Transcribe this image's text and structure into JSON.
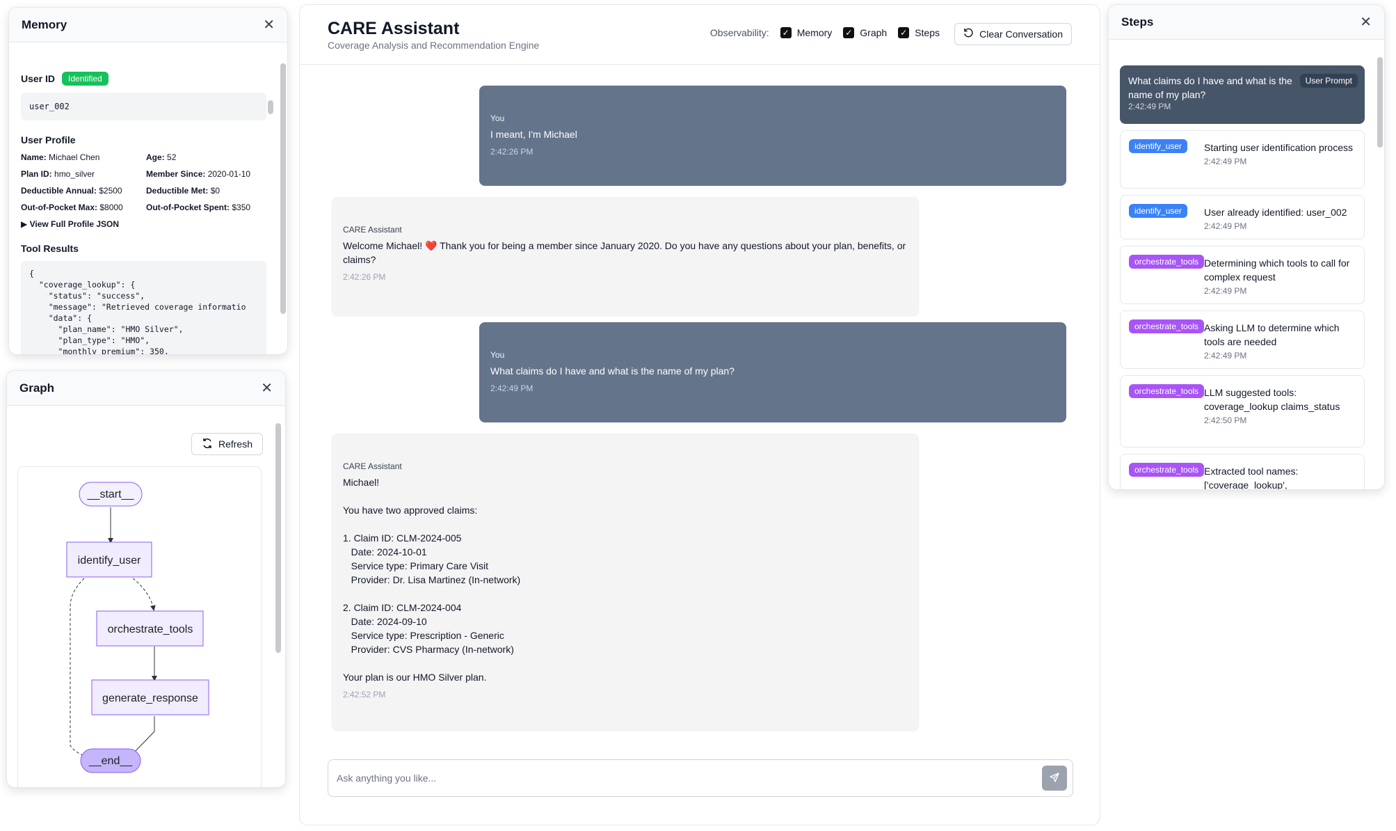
{
  "memory": {
    "title": "Memory",
    "user_id_label": "User ID",
    "identified_badge": "Identified",
    "user_id_value": "user_002",
    "profile_title": "User Profile",
    "profile": [
      {
        "label": "Name:",
        "value": "Michael Chen"
      },
      {
        "label": "Age:",
        "value": "52"
      },
      {
        "label": "Plan ID:",
        "value": "hmo_silver"
      },
      {
        "label": "Member Since:",
        "value": "2020-01-10"
      },
      {
        "label": "Deductible Annual:",
        "value": "$2500"
      },
      {
        "label": "Deductible Met:",
        "value": "$0"
      },
      {
        "label": "Out-of-Pocket Max:",
        "value": "$8000"
      },
      {
        "label": "Out-of-Pocket Spent:",
        "value": "$350"
      }
    ],
    "view_json": "View Full Profile JSON",
    "tool_results_title": "Tool Results",
    "tool_results_json": "{\n  \"coverage_lookup\": {\n    \"status\": \"success\",\n    \"message\": \"Retrieved coverage informatio\n    \"data\": {\n      \"plan_name\": \"HMO Silver\",\n      \"plan_type\": \"HMO\",\n      \"monthly_premium\": 350,"
  },
  "graph": {
    "title": "Graph",
    "refresh_label": "Refresh",
    "nodes": {
      "start": "__start__",
      "identify": "identify_user",
      "orchestrate": "orchestrate_tools",
      "generate": "generate_response",
      "end": "__end__"
    }
  },
  "chat": {
    "title": "CARE Assistant",
    "subtitle": "Coverage Analysis and Recommendation Engine",
    "observability_label": "Observability:",
    "toggles": [
      {
        "label": "Memory",
        "checked": true
      },
      {
        "label": "Graph",
        "checked": true
      },
      {
        "label": "Steps",
        "checked": true
      }
    ],
    "clear_label": "Clear Conversation",
    "messages": [
      {
        "sender": "You",
        "text": "I meant, I'm Michael",
        "time": "2:42:26 PM"
      },
      {
        "sender": "CARE Assistant",
        "text": "Welcome Michael! ❤️ Thank you for being a member since January 2020. Do you have any questions about your plan, benefits, or claims?",
        "time": "2:42:26 PM"
      },
      {
        "sender": "You",
        "text": "What claims do I have and what is the name of my plan?",
        "time": "2:42:49 PM"
      },
      {
        "sender": "CARE Assistant",
        "text": "Michael!\n\nYou have two approved claims:\n\n1. Claim ID: CLM-2024-005\n   Date: 2024-10-01\n   Service type: Primary Care Visit\n   Provider: Dr. Lisa Martinez (In-network)\n\n2. Claim ID: CLM-2024-004\n   Date: 2024-09-10\n   Service type: Prescription - Generic\n   Provider: CVS Pharmacy (In-network)\n\nYour plan is our HMO Silver plan.",
        "time": "2:42:52 PM"
      }
    ],
    "input_placeholder": "Ask anything you like..."
  },
  "steps": {
    "title": "Steps",
    "items": [
      {
        "tag": "User Prompt",
        "text": "What claims do I have and what is the name of my plan?",
        "time": "2:42:49 PM"
      },
      {
        "tag": "identify_user",
        "text": "Starting user identification process",
        "time": "2:42:49 PM"
      },
      {
        "tag": "identify_user",
        "text": "User already identified: user_002",
        "time": "2:42:49 PM"
      },
      {
        "tag": "orchestrate_tools",
        "text": "Determining which tools to call for complex request",
        "time": "2:42:49 PM"
      },
      {
        "tag": "orchestrate_tools",
        "text": "Asking LLM to determine which tools are needed",
        "time": "2:42:49 PM"
      },
      {
        "tag": "orchestrate_tools",
        "text": "LLM suggested tools: coverage_lookup claims_status",
        "time": "2:42:50 PM"
      },
      {
        "tag": "orchestrate_tools",
        "text": "Extracted tool names: ['coverage_lookup',",
        "time": ""
      }
    ]
  }
}
